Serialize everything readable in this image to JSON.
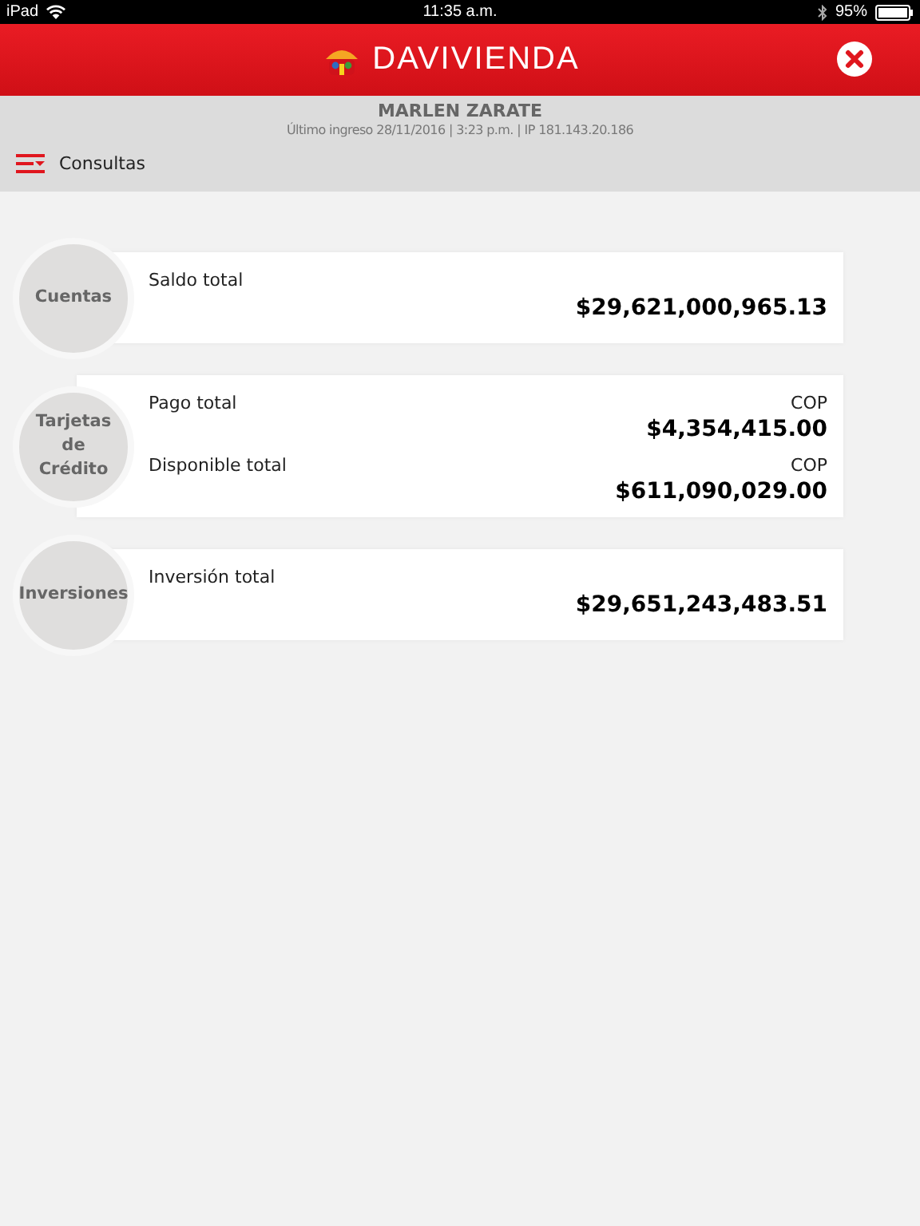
{
  "status_bar": {
    "device": "iPad",
    "time": "11:35 a.m.",
    "battery": "95%"
  },
  "header": {
    "logo": "DAVIVIENDA"
  },
  "user": {
    "name": "MARLEN ZARATE",
    "last_login": "Último ingreso 28/11/2016 | 3:23 p.m. | IP 181.143.20.186"
  },
  "menu": {
    "label": "Consultas"
  },
  "sections": [
    {
      "title": "Cuentas",
      "items": [
        {
          "label": "Saldo total",
          "amount": "$29,621,000,965.13"
        }
      ]
    },
    {
      "title": "Tarjetas de Crédito",
      "items": [
        {
          "label": "Pago total",
          "currency": "COP",
          "amount": "$4,354,415.00"
        },
        {
          "label": "Disponible total",
          "currency": "COP",
          "amount": "$611,090,029.00"
        }
      ]
    },
    {
      "title": "Inversiones",
      "items": [
        {
          "label": "Inversión total",
          "amount": "$29,651,243,483.51"
        }
      ]
    }
  ]
}
